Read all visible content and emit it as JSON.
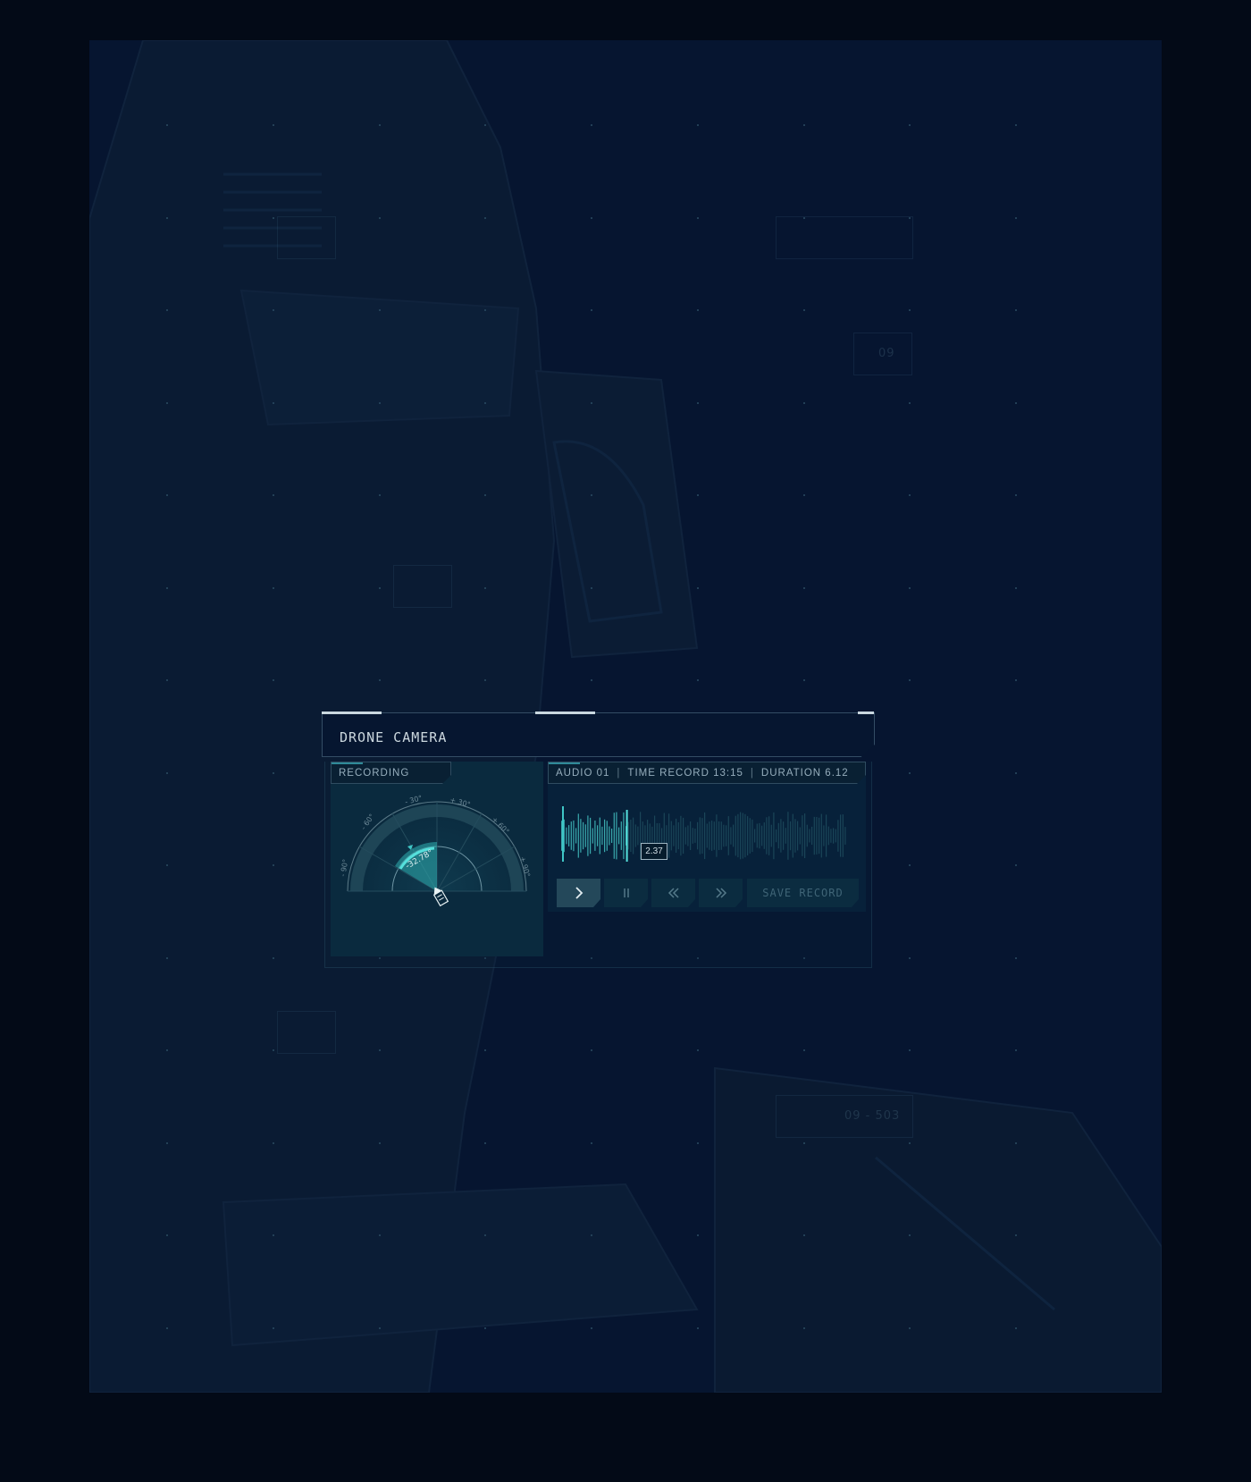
{
  "panel": {
    "title": "DRONE CAMERA"
  },
  "angle_module": {
    "header": "RECORDING ANGLE",
    "ticks": [
      "- 90°",
      "- 60°",
      "- 30°",
      "+ 30°",
      "+ 60°",
      "+ 90°"
    ],
    "current_angle": "-32.78°"
  },
  "audio_module": {
    "track": "AUDIO 01",
    "time_record": "TIME RECORD  13:15",
    "duration": "DURATION  6.12",
    "separator": "|",
    "playhead_time": "2.37",
    "playback_progress": 0.23
  },
  "controls": {
    "play_icon": "play-icon",
    "pause_icon": "pause-icon",
    "rewind_icon": "rewind-icon",
    "fast_forward_icon": "fast-forward-icon",
    "save_label": "SAVE RECORD"
  },
  "background": {
    "label_1": "09",
    "label_2": "09 - 503"
  },
  "colors": {
    "accent": "#3fc6c6",
    "background": "#061530",
    "outer": "#030a17"
  }
}
